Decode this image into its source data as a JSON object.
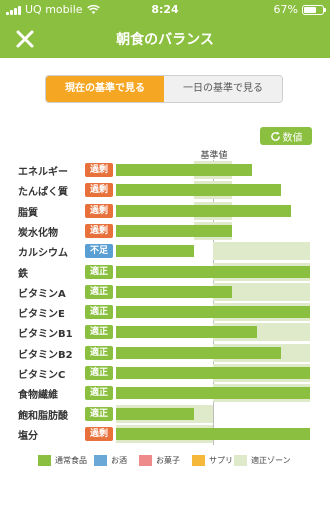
{
  "status_bar": {
    "carrier": "UQ mobile",
    "time": "8:24",
    "battery": "67%",
    "battery_level": 0.67
  },
  "nav": {
    "close_icon": "close-icon",
    "title": "朝食のバランス"
  },
  "segment": {
    "active_label": "現在の基準で見る",
    "inactive_label": "一日の基準で見る"
  },
  "values_button": {
    "icon": "refresh-icon",
    "label": "数値"
  },
  "colors": {
    "accent": "#8bbf3f",
    "excess": "#e8703a",
    "shortage": "#5a9fd4",
    "adequate": "#8bbf3f",
    "zone": "#dfeacb",
    "snack": "#ee8a8a",
    "supplement": "#f5b83a",
    "alcohol": "#6aa8d8"
  },
  "chart_data": {
    "type": "bar",
    "orientation": "horizontal",
    "baseline_label": "基準値",
    "categories": [
      "エネルギー",
      "たんぱく質",
      "脂質",
      "炭水化物",
      "カルシウム",
      "鉄",
      "ビタミンA",
      "ビタミンE",
      "ビタミンB1",
      "ビタミンB2",
      "ビタミンC",
      "食物繊維",
      "飽和脂肪酸",
      "塩分"
    ],
    "status": [
      "過剰",
      "過剰",
      "過剰",
      "過剰",
      "不足",
      "適正",
      "適正",
      "適正",
      "適正",
      "適正",
      "適正",
      "適正",
      "適正",
      "過剰"
    ],
    "series": [
      {
        "name": "通常食品",
        "values": [
          1.4,
          1.7,
          1.8,
          1.2,
          0.8,
          2.0,
          1.2,
          2.0,
          1.45,
          1.7,
          2.0,
          2.0,
          0.8,
          2.0
        ]
      }
    ],
    "adequate_zones": [
      [
        0.8,
        1.2
      ],
      [
        0.8,
        1.2
      ],
      [
        0.8,
        1.2
      ],
      [
        0.8,
        1.2
      ],
      [
        1.0,
        2.0
      ],
      [
        1.0,
        2.0
      ],
      [
        1.0,
        2.0
      ],
      [
        1.0,
        2.0
      ],
      [
        1.0,
        2.0
      ],
      [
        1.0,
        2.0
      ],
      [
        1.0,
        2.0
      ],
      [
        1.0,
        2.0
      ],
      [
        0.0,
        1.0
      ],
      [
        0.0,
        1.0
      ]
    ],
    "xlim": [
      0,
      2.0
    ],
    "baseline_value": 1.0,
    "legend": [
      "通常食品",
      "お酒",
      "お菓子",
      "サプリ",
      "適正ゾーン"
    ],
    "legend_colors": [
      "#8bbf3f",
      "#6aa8d8",
      "#ee8a8a",
      "#f5b83a",
      "#dfeacb"
    ]
  }
}
